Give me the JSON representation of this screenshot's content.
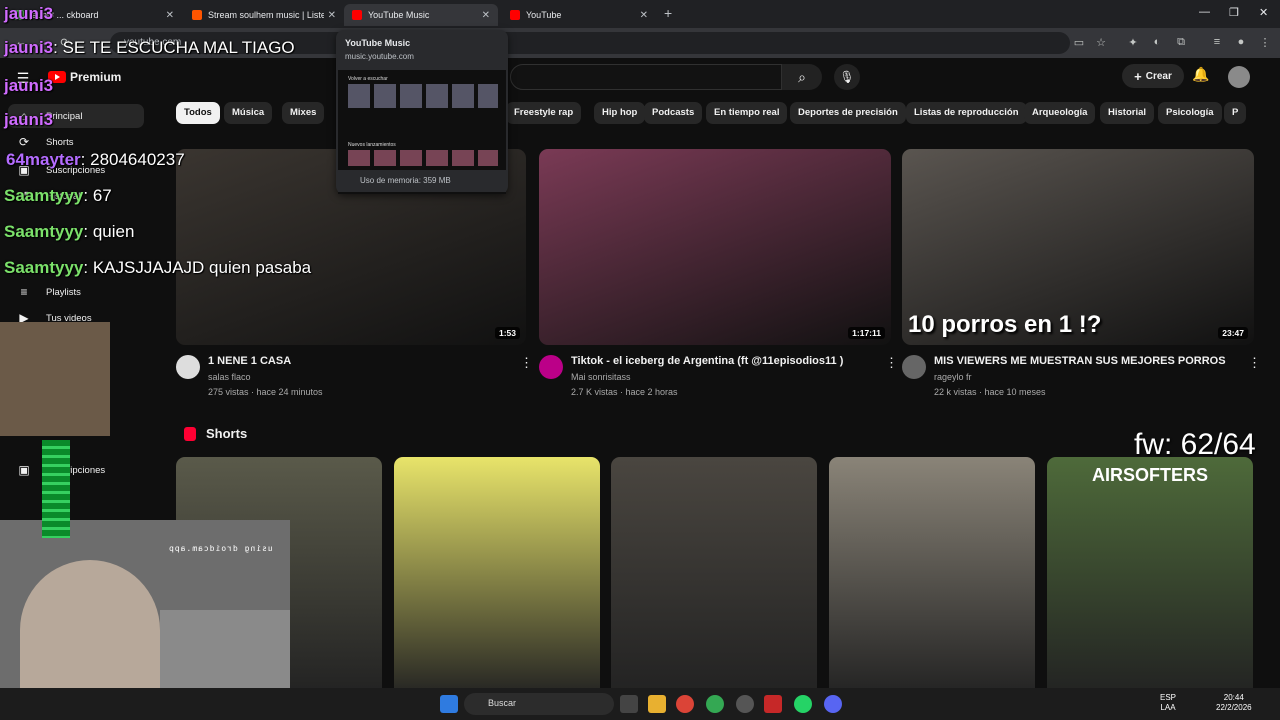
{
  "browser": {
    "tabs": [
      {
        "label": "jauni3 ... ckboard",
        "favicon_color": "#4caf50"
      },
      {
        "label": "Stream soulhem music | Listen",
        "favicon_color": "#ff5500"
      },
      {
        "label": "YouTube Music",
        "favicon_color": "#ff0000",
        "active": true
      },
      {
        "label": "YouTube",
        "favicon_color": "#ff0000"
      }
    ],
    "new_tab": "+",
    "window_controls": [
      "—",
      "❐",
      "✕"
    ],
    "address": "youtube.com"
  },
  "hover_card": {
    "title": "YouTube Music",
    "url": "music.youtube.com",
    "preview_heading": "Volver a escuchar",
    "preview_section": "Nuevos lanzamientos",
    "memory": "Uso de memoria: 359 MB"
  },
  "youtube": {
    "logo": "Premium",
    "sidebar": [
      {
        "label": "Principal",
        "icon": "home-icon"
      },
      {
        "label": "Shorts",
        "icon": "shorts-icon"
      },
      {
        "label": "Suscripciones",
        "icon": "subscriptions-icon"
      },
      {
        "label": "Historial",
        "icon": "history-icon"
      },
      {
        "label": "Playlists",
        "icon": "playlist-icon"
      },
      {
        "label": "Tus videos",
        "icon": "video-icon"
      },
      {
        "label": "Suscripciones",
        "icon": "subscriptions-icon"
      }
    ],
    "chips": [
      "Todos",
      "Música",
      "Mixes",
      "Freestyle rap",
      "Hip hop",
      "Podcasts",
      "En tiempo real",
      "Deportes de precisión",
      "Listas de reproducción",
      "Arqueología",
      "Historial",
      "Psicología",
      "P"
    ],
    "create_label": "Crear",
    "videos": [
      {
        "title": "1 NENE 1 CASA",
        "channel": "salas flaco",
        "meta": "275 vistas · hace 24 minutos",
        "duration": "1:53",
        "color": "#3a3530"
      },
      {
        "title": "Tiktok - el iceberg de Argentina (ft @11episodios11 )",
        "channel": "Mai sonrisitass",
        "meta": "2.7 K vistas · hace 2 horas",
        "duration": "1:17:11",
        "color": "#7a3a55"
      },
      {
        "title": "MIS VIEWERS ME MUESTRAN SUS MEJORES PORROS",
        "channel": "rageylo fr",
        "meta": "22 k vistas · hace 10 meses",
        "duration": "23:47",
        "color": "#5a5550",
        "overlay": "10 porros en 1 !?"
      }
    ],
    "shorts_heading": "Shorts",
    "shorts": [
      {
        "color": "#5a5a4a",
        "caption": ""
      },
      {
        "color": "#e8e46a",
        "caption": ""
      },
      {
        "color": "#4a4640",
        "caption": ""
      },
      {
        "color": "#8a8478",
        "caption": ""
      },
      {
        "color": "#4e6a3a",
        "caption": "AIRSOFTERS"
      }
    ]
  },
  "stream_overlay": {
    "chat": [
      {
        "user": "jauni3",
        "text": ""
      },
      {
        "user": "jauni3",
        "text": ": SE TE ESCUCHA MAL TIAGO"
      },
      {
        "user": "jauni3",
        "text": ""
      },
      {
        "user": "jauni3",
        "text": ""
      },
      {
        "user": "64mayter",
        "text": ": 2804640237"
      },
      {
        "user": "Saamtyyy",
        "text": ": 67"
      },
      {
        "user": "Saamtyyy",
        "text": ": quien"
      },
      {
        "user": "Saamtyyy",
        "text": ": KAJSJJAJAJD quien pasaba"
      }
    ],
    "fw_counter": "fw: 62/64",
    "webcam_watermark": "using droidcam.app"
  },
  "taskbar": {
    "search_label": "Buscar",
    "language": "ESP\nLAA",
    "time": "20:44",
    "date": "22/2/2026"
  }
}
